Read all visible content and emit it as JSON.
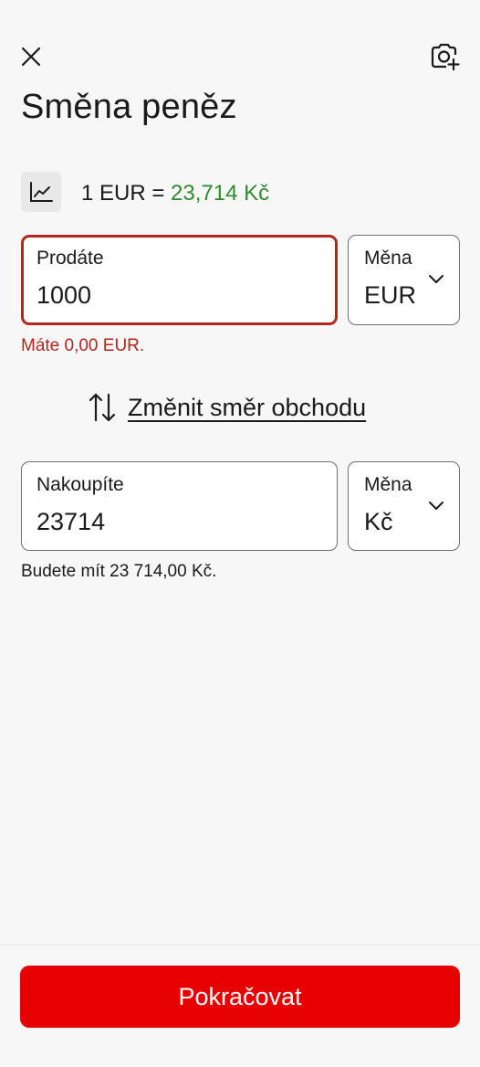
{
  "header": {
    "title": "Směna peněz",
    "close_icon": "close-icon",
    "scan_icon": "camera-scan-icon"
  },
  "rate": {
    "prefix": "1 EUR = ",
    "value": "23,714 Kč",
    "chart_icon": "chart-line-icon"
  },
  "sell": {
    "label": "Prodáte",
    "value": "1000",
    "error_message": "Máte 0,00 EUR.",
    "currency_label": "Měna",
    "currency_value": "EUR"
  },
  "swap": {
    "icon": "swap-vertical-icon",
    "label": "Změnit směr obchodu"
  },
  "buy": {
    "label": "Nakoupíte",
    "value": "23714",
    "hint": "Budete mít 23 714,00 Kč.",
    "currency_label": "Měna",
    "currency_value": "Kč"
  },
  "footer": {
    "continue_label": "Pokračovat"
  },
  "colors": {
    "background": "#f7f7f7",
    "error": "#b3261e",
    "rate_value": "#2e8b2e",
    "primary_button": "#e60000"
  }
}
